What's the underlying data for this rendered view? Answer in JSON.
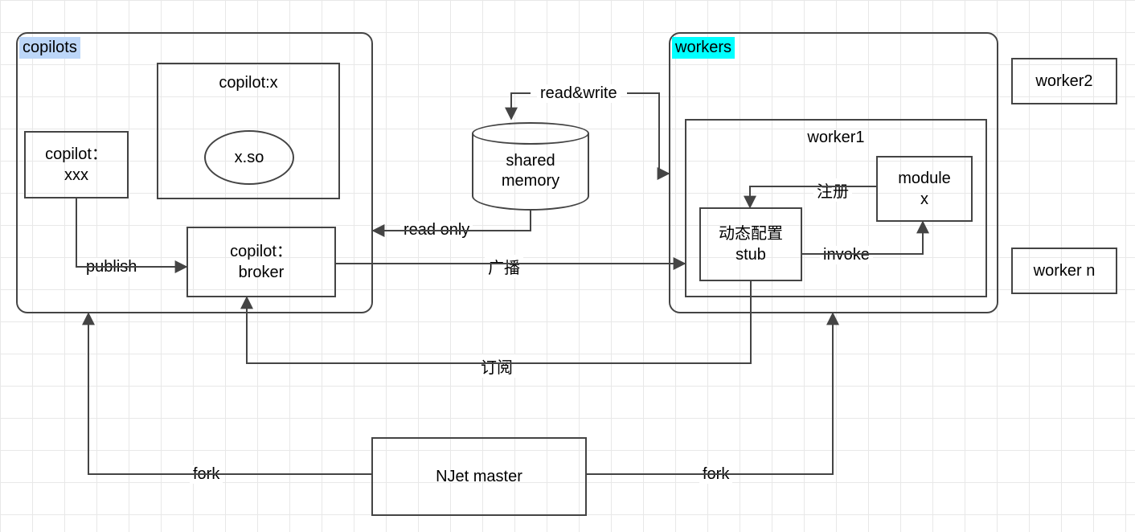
{
  "groups": {
    "copilots_label": "copilots",
    "workers_label": "workers"
  },
  "nodes": {
    "copilot_xxx": "copilot：\nxxx",
    "copilot_x_title": "copilot:x",
    "x_so": "x.so",
    "copilot_broker": "copilot：\nbroker",
    "shared_memory": "shared\nmemory",
    "worker1_title": "worker1",
    "dyn_stub": "动态配置\nstub",
    "module_x": "module\nx",
    "worker2": "worker2",
    "worker_n": "worker n",
    "njet_master": "NJet master"
  },
  "edges": {
    "publish": "publish",
    "read_only": "read only",
    "read_write": "read&write",
    "broadcast": "广播",
    "subscribe": "订阅",
    "register": "注册",
    "invoke": "invoke",
    "fork_left": "fork",
    "fork_right": "fork"
  }
}
